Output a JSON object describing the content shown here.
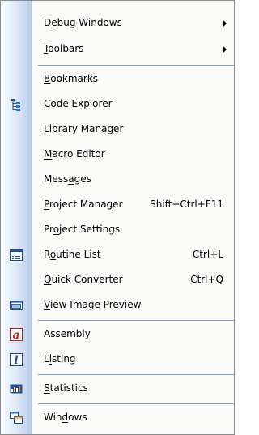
{
  "menu": {
    "items": [
      {
        "pre": "D",
        "u": "e",
        "post": "bug Windows",
        "shortcut": "",
        "submenu": true,
        "icon": ""
      },
      {
        "pre": "",
        "u": "T",
        "post": "oolbars",
        "shortcut": "",
        "submenu": true,
        "icon": ""
      },
      {
        "pre": "",
        "u": "B",
        "post": "ookmarks",
        "shortcut": "",
        "submenu": false,
        "icon": ""
      },
      {
        "pre": "",
        "u": "C",
        "post": "ode Explorer",
        "shortcut": "",
        "submenu": false,
        "icon": "tree-icon"
      },
      {
        "pre": "",
        "u": "L",
        "post": "ibrary Manager",
        "shortcut": "",
        "submenu": false,
        "icon": ""
      },
      {
        "pre": "",
        "u": "M",
        "post": "acro Editor",
        "shortcut": "",
        "submenu": false,
        "icon": ""
      },
      {
        "pre": "Mess",
        "u": "a",
        "post": "ges",
        "shortcut": "",
        "submenu": false,
        "icon": ""
      },
      {
        "pre": "",
        "u": "P",
        "post": "roject Manager",
        "shortcut": "Shift+Ctrl+F11",
        "submenu": false,
        "icon": ""
      },
      {
        "pre": "Pr",
        "u": "o",
        "post": "ject Settings",
        "shortcut": "",
        "submenu": false,
        "icon": ""
      },
      {
        "pre": "R",
        "u": "o",
        "post": "utine List",
        "shortcut": "Ctrl+L",
        "submenu": false,
        "icon": "list-icon"
      },
      {
        "pre": "",
        "u": "Q",
        "post": "uick Converter",
        "shortcut": "Ctrl+Q",
        "submenu": false,
        "icon": ""
      },
      {
        "pre": "",
        "u": "V",
        "post": "iew Image Preview",
        "shortcut": "",
        "submenu": false,
        "icon": "image-preview-icon"
      },
      {
        "pre": "Assembl",
        "u": "y",
        "post": "",
        "shortcut": "",
        "submenu": false,
        "icon": "assembly-icon"
      },
      {
        "pre": "L",
        "u": "i",
        "post": "sting",
        "shortcut": "",
        "submenu": false,
        "icon": "listing-icon"
      },
      {
        "pre": "",
        "u": "S",
        "post": "tatistics",
        "shortcut": "",
        "submenu": false,
        "icon": "statistics-icon"
      },
      {
        "pre": "Win",
        "u": "d",
        "post": "ows",
        "shortcut": "",
        "submenu": false,
        "icon": "windows-icon"
      }
    ]
  },
  "colors": {
    "separator": "#7a9fd1",
    "gutter_dark": "#b9cdea",
    "gutter_light": "#fafcff"
  }
}
